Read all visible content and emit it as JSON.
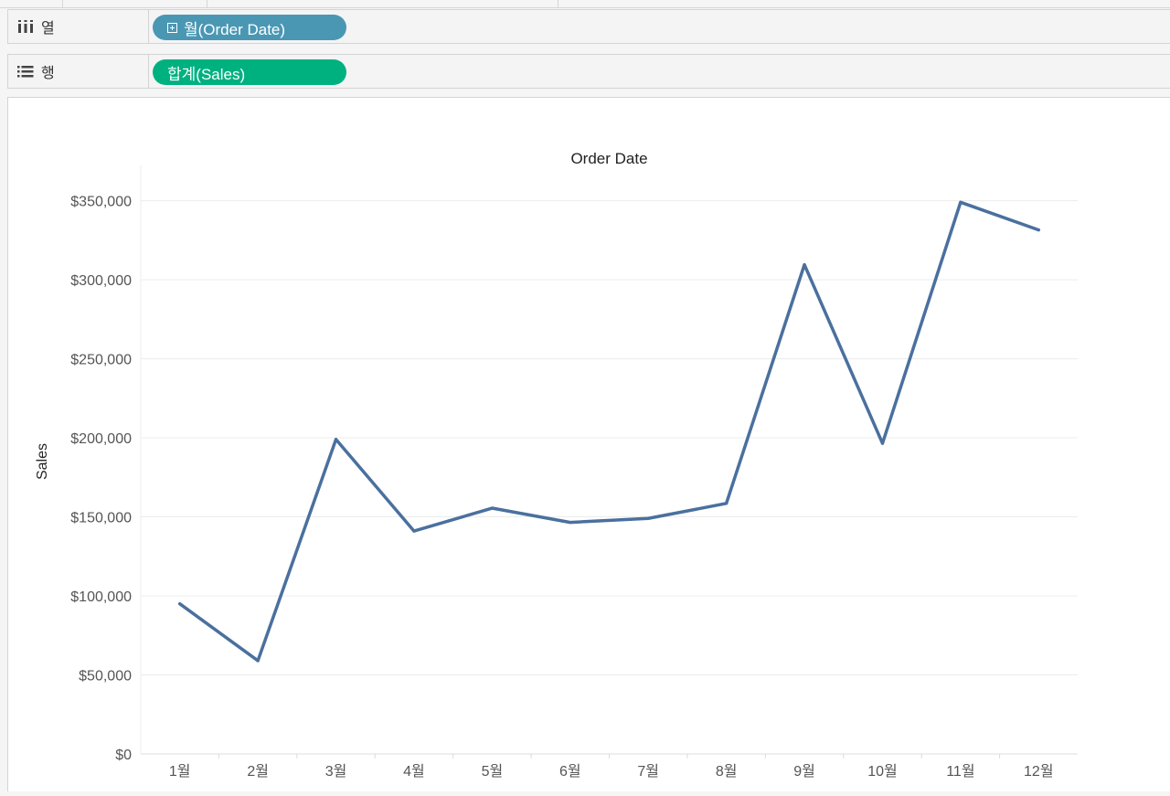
{
  "shelves": {
    "columns": {
      "label": "열",
      "pill": "월(Order Date)",
      "pill_color": "#4a97b4"
    },
    "rows": {
      "label": "행",
      "pill": "합계(Sales)",
      "pill_color": "#00b180"
    }
  },
  "colors": {
    "line": "#4a709e",
    "grid": "#ececec",
    "axis_text": "#555555"
  },
  "chart_data": {
    "type": "line",
    "title": "Order Date",
    "xlabel": "",
    "ylabel": "Sales",
    "categories": [
      "1월",
      "2월",
      "3월",
      "4월",
      "5월",
      "6월",
      "7월",
      "8월",
      "9월",
      "10월",
      "11월",
      "12월"
    ],
    "series": [
      {
        "values": [
          95000,
          59000,
          199000,
          141000,
          155500,
          146500,
          149000,
          158500,
          309500,
          196500,
          349000,
          331500
        ]
      }
    ],
    "ylim": [
      0,
      370000
    ],
    "yticks": [
      0,
      50000,
      100000,
      150000,
      200000,
      250000,
      300000,
      350000
    ],
    "ytick_labels": [
      "$0",
      "$50,000",
      "$100,000",
      "$150,000",
      "$200,000",
      "$250,000",
      "$300,000",
      "$350,000"
    ],
    "grid": true,
    "legend": "none"
  }
}
